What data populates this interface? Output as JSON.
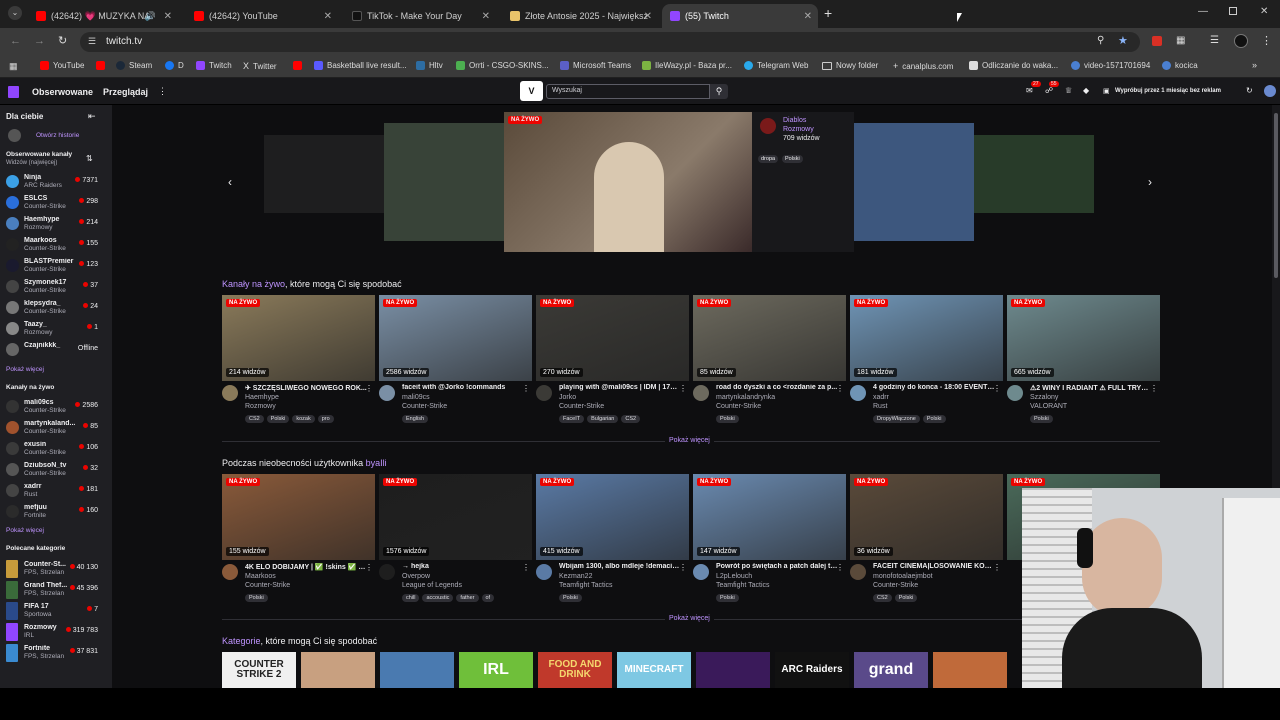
{
  "browser": {
    "tabs": [
      {
        "label": "(42642) 💗 MUZYKA NA",
        "color": "#ff0000"
      },
      {
        "label": "(42642) YouTube",
        "color": "#ff0000"
      },
      {
        "label": "TikTok - Make Your Day",
        "color": "#000000"
      },
      {
        "label": "Złote Antosie 2025 - Największ",
        "color": "#e9c46a"
      },
      {
        "label": "(55) Twitch",
        "color": "#9146ff"
      }
    ],
    "url": "twitch.tv",
    "bookmarks": [
      "YouTube",
      "",
      "Steam",
      "D",
      "Twitch",
      "Twitter",
      "",
      "Basketball live result...",
      "Hltv",
      "Orrti - CSGO-SKINS...",
      "Microsoft Teams",
      "IleWazy.pl - Baza pr...",
      "Telegram Web",
      "Nowy folder",
      "canalplus.com",
      "Odliczanie do waka...",
      "video-1571701694",
      "kocica"
    ]
  },
  "twitch_nav": {
    "following": "Obserwowane",
    "browse": "Przeglądaj",
    "search_placeholder": "Wyszukaj",
    "notif_count_1": "27",
    "notif_count_2": "55",
    "promo": "Wypróbuj przez 1 miesiąc bez reklam"
  },
  "sidebar": {
    "for_you": "Dla ciebie",
    "open_history": "Otwórz historie",
    "followed_header": "Obserwowane kanały",
    "followed_sub": "Widzów (najwięcej)",
    "followed": [
      {
        "name": "Ninja",
        "game": "ARC Raiders",
        "viewers": "7371",
        "color": "#3ba0e6"
      },
      {
        "name": "ESLCS",
        "game": "Counter-Strike",
        "viewers": "298",
        "color": "#2a6fdb"
      },
      {
        "name": "Haemhype",
        "game": "Rozmowy",
        "viewers": "214",
        "color": "#4a7fbf"
      },
      {
        "name": "Maarkoos",
        "game": "Counter-Strike",
        "viewers": "155",
        "color": "#222222"
      },
      {
        "name": "BLASTPremier",
        "game": "Counter-Strike",
        "viewers": "123",
        "color": "#1a1a2e"
      },
      {
        "name": "Szymonek17",
        "game": "Counter-Strike",
        "viewers": "37",
        "color": "#444444"
      },
      {
        "name": "klepsydra_",
        "game": "Counter-Strike",
        "viewers": "24",
        "color": "#777777"
      },
      {
        "name": "Taazy_",
        "game": "Rozmowy",
        "viewers": "1",
        "color": "#888888"
      },
      {
        "name": "Czajnikkk_",
        "game": "",
        "viewers": "Offline",
        "color": "#666666"
      }
    ],
    "show_more": "Pokaż więcej",
    "live_header": "Kanały na żywo",
    "live": [
      {
        "name": "mali09cs",
        "game": "Counter-Strike",
        "viewers": "2586",
        "color": "#333333"
      },
      {
        "name": "martynkaland...",
        "game": "Counter-Strike",
        "viewers": "85",
        "color": "#a0522d"
      },
      {
        "name": "exusin",
        "game": "Counter-Strike",
        "viewers": "106",
        "color": "#3a3a3a"
      },
      {
        "name": "DziubsoN_tv",
        "game": "Counter-Strike",
        "viewers": "32",
        "color": "#555555"
      },
      {
        "name": "xadrr",
        "game": "Rust",
        "viewers": "181",
        "color": "#444444"
      },
      {
        "name": "mefjuu",
        "game": "Fortnite",
        "viewers": "160",
        "color": "#2b2b2b"
      }
    ],
    "show_more_2": "Pokaż więcej",
    "cats_header": "Polecane kategorie",
    "cats": [
      {
        "name": "Counter-St...",
        "game": "FPS, Strzelan",
        "viewers": "40 130",
        "color": "#c79b3b"
      },
      {
        "name": "Grand Thef...",
        "game": "FPS, Strzelan",
        "viewers": "45 396",
        "color": "#3a6b3a"
      },
      {
        "name": "FIFA 17",
        "game": "Sportowa",
        "viewers": "7",
        "color": "#2a4a8a"
      },
      {
        "name": "Rozmowy",
        "game": "IRL",
        "viewers": "319 783",
        "color": "#9146ff"
      },
      {
        "name": "Fortnite",
        "game": "FPS, Strzelan",
        "viewers": "37 831",
        "color": "#3a8ad0"
      }
    ]
  },
  "hero": {
    "live": "NA ŻYWO",
    "channel": "Diablos",
    "category": "Rozmowy",
    "viewers": "709 widzów",
    "tags": [
      "dropa",
      "Polski"
    ]
  },
  "section1": {
    "title_pre": "Kanały na żywo",
    "title_post": ", które mogą Ci się spodobać",
    "show_more": "Pokaż więcej"
  },
  "cards1": [
    {
      "live": "NA ŻYWO",
      "viewers": "214 widzów",
      "title": "✈ SZCZĘŚLIWEGO NOWEGO ROK...",
      "channel": "Haemhype",
      "game": "Rozmowy",
      "tags": [
        "CS2",
        "Polski",
        "kozak",
        "pro"
      ],
      "bg": "#8a7a5a"
    },
    {
      "live": "NA ŻYWO",
      "viewers": "2586 widzów",
      "title": "faceit with @Jorko !commands",
      "channel": "mali09cs",
      "game": "Counter-Strike",
      "tags": [
        "English"
      ],
      "bg": "#7a8fa5"
    },
    {
      "live": "NA ŻYWO",
      "viewers": "270 widzów",
      "title": "playing with @mali09cs | IDM | 17yo...",
      "channel": "Jorko",
      "game": "Counter-Strike",
      "tags": [
        "FaceIT",
        "Bulgarian",
        "CS2"
      ],
      "bg": "#3b3a36"
    },
    {
      "live": "NA ŻYWO",
      "viewers": "85 widzów",
      "title": "road do dyszki a co <rozdanie za p...",
      "channel": "martynkalandrynka",
      "game": "Counter-Strike",
      "tags": [
        "Polski"
      ],
      "bg": "#6d6a5e"
    },
    {
      "live": "NA ŻYWO",
      "viewers": "181 widzów",
      "title": "4 godziny do konca - 18:00 EVENT ...",
      "channel": "xadrr",
      "game": "Rust",
      "tags": [
        "DropyWłączone",
        "Polski"
      ],
      "bg": "#6f94b5"
    },
    {
      "live": "NA ŻYWO",
      "viewers": "665 widzów",
      "title": "⚠2 WINY I RADIANT ⚠ FULL TRYH...",
      "channel": "Szzalony",
      "game": "VALORANT",
      "tags": [
        "Polski"
      ],
      "bg": "#6e8a8e"
    }
  ],
  "section2": {
    "title_pre": "Podczas nieobecności użytkownika ",
    "title_user": "byaIli",
    "show_more": "Pokaż więcej"
  },
  "cards2": [
    {
      "live": "NA ŻYWO",
      "viewers": "155 widzów",
      "title": "4K ELO DOBIJAMY | ✅ !skins ✅ !k...",
      "channel": "Maarkoos",
      "game": "Counter-Strike",
      "tags": [
        "Polski"
      ],
      "bg": "#8a5a3a"
    },
    {
      "live": "NA ŻYWO",
      "viewers": "1576 widzów",
      "title": "→ hejka",
      "channel": "Overpow",
      "game": "League of Legends",
      "tags": [
        "chill",
        "accoustic",
        "father",
        "of"
      ],
      "bg": "#1e1e1e"
    },
    {
      "live": "NA ŻYWO",
      "viewers": "415 widzów",
      "title": "Wbijam 1300, albo mdleje !demacia...",
      "channel": "Kezman22",
      "game": "Teamfight Tactics",
      "tags": [
        "Polski"
      ],
      "bg": "#5a7aa5"
    },
    {
      "live": "NA ŻYWO",
      "viewers": "147 widzów",
      "title": "Powrót po świętach a patch dalej te...",
      "channel": "L2pLelouch",
      "game": "Teamfight Tactics",
      "tags": [
        "Polski"
      ],
      "bg": "#6a8ab0"
    },
    {
      "live": "NA ŻYWO",
      "viewers": "36 widzów",
      "title": "FACEIT CINEMA|LOSOWANIE KOSK...",
      "channel": "monofotoalaejmbot",
      "game": "Counter-Strike",
      "tags": [
        "CS2",
        "Polski"
      ],
      "bg": "#5a4a3a"
    },
    {
      "live": "NA ŻYWO",
      "viewers": "",
      "title": "",
      "channel": "",
      "game": "",
      "tags": [],
      "bg": "#4a6a5a"
    }
  ],
  "section3": {
    "title_pre": "Kategorie",
    "title_post": ", które mogą Ci się spodobać"
  },
  "categories": [
    {
      "label": "COUNTER STRIKE 2",
      "bg": "#f0f0f0",
      "fg": "#222"
    },
    {
      "label": "",
      "bg": "#c8a080",
      "fg": "#fff"
    },
    {
      "label": "",
      "bg": "#4a7ab0",
      "fg": "#fff"
    },
    {
      "label": "IRL",
      "bg": "#6fbf3a",
      "fg": "#fff"
    },
    {
      "label": "FOOD AND DRINK",
      "bg": "#c0392b",
      "fg": "#f5d76e"
    },
    {
      "label": "MINECRAFT",
      "bg": "#7ec8e3",
      "fg": "#fff"
    },
    {
      "label": "",
      "bg": "#3a1a5a",
      "fg": "#fff"
    },
    {
      "label": "ARC Raiders",
      "bg": "#111111",
      "fg": "#fff"
    },
    {
      "label": "grand",
      "bg": "#5a4a8a",
      "fg": "#fff"
    },
    {
      "label": "",
      "bg": "#c06a3a",
      "fg": "#fff"
    }
  ]
}
